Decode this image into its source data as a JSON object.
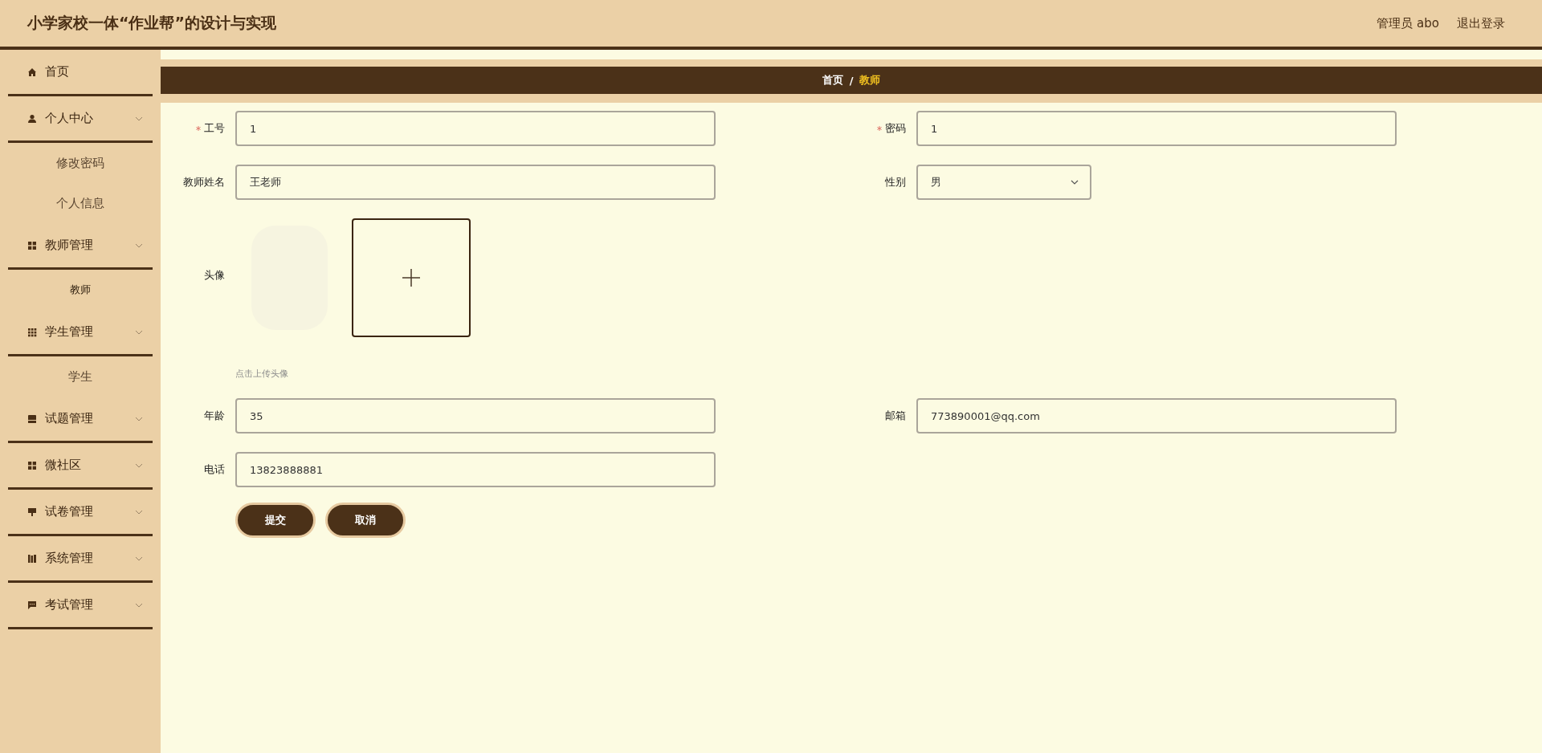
{
  "header": {
    "title": "小学家校一体“作业帮”的设计与实现",
    "user": "管理员 abo",
    "logout": "退出登录"
  },
  "sidebar": {
    "items": [
      {
        "label": "首页"
      },
      {
        "label": "个人中心",
        "children": [
          {
            "label": "修改密码",
            "selected": false
          },
          {
            "label": "个人信息",
            "selected": false
          }
        ]
      },
      {
        "label": "教师管理",
        "children": [
          {
            "label": "教师",
            "selected": true
          }
        ]
      },
      {
        "label": "学生管理",
        "children": [
          {
            "label": "学生",
            "selected": false
          }
        ]
      },
      {
        "label": "试题管理"
      },
      {
        "label": "微社区"
      },
      {
        "label": "试卷管理"
      },
      {
        "label": "系统管理"
      },
      {
        "label": "考试管理"
      }
    ]
  },
  "breadcrumb": [
    {
      "label": "首页",
      "selected": false
    },
    {
      "label": "/",
      "selected": false
    },
    {
      "label": "教师",
      "selected": true
    }
  ],
  "form": {
    "rows": [
      [
        {
          "kind": "text",
          "label": "工号",
          "required": true,
          "value": "1"
        },
        {
          "kind": "text",
          "label": "密码",
          "required": true,
          "value": "1"
        }
      ],
      [
        {
          "kind": "text",
          "label": "教师姓名",
          "value": "王老师"
        },
        {
          "kind": "select",
          "label": "性别",
          "value": "男"
        }
      ],
      [
        {
          "kind": "upload",
          "label": "头像",
          "hint": "点击上传头像"
        }
      ],
      [
        {
          "kind": "text",
          "label": "年龄",
          "value": "35"
        },
        {
          "kind": "text",
          "label": "邮箱",
          "value": "773890001@qq.com"
        }
      ],
      [
        {
          "kind": "text",
          "label": "电话",
          "value": "13823888881"
        }
      ]
    ],
    "buttons": [
      "提交",
      "取消"
    ]
  }
}
